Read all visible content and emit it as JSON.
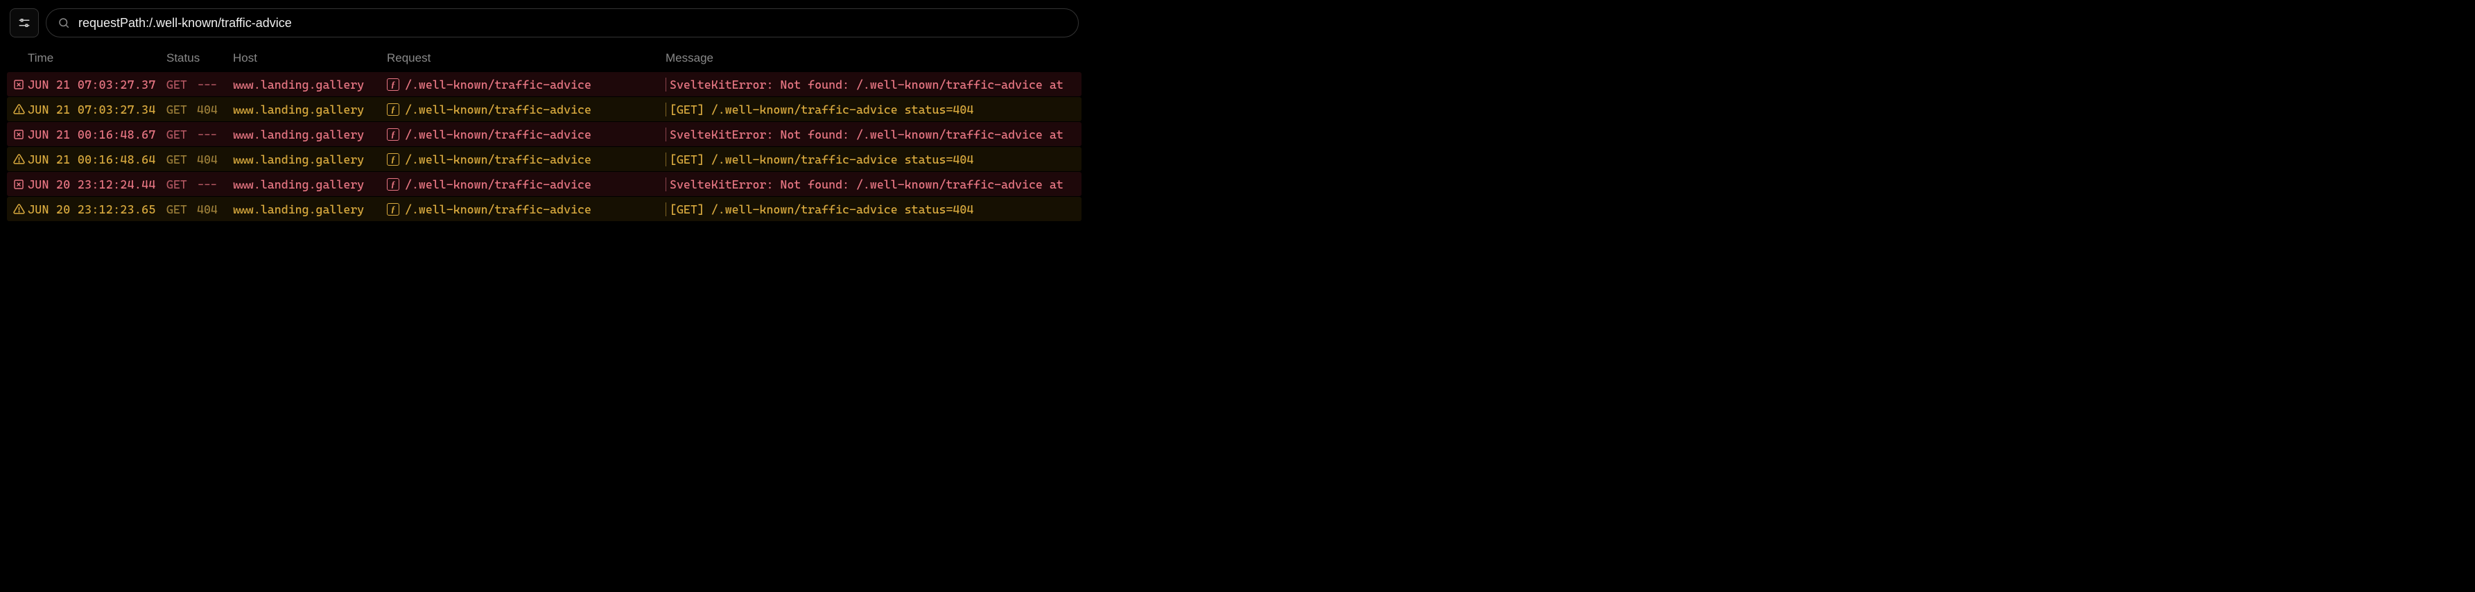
{
  "toolbar": {
    "search_value": "requestPath:/.well-known/traffic-advice"
  },
  "columns": {
    "time": "Time",
    "status": "Status",
    "host": "Host",
    "request": "Request",
    "message": "Message"
  },
  "logs": [
    {
      "level": "error",
      "time": "JUN 21 07:03:27.37",
      "method": "GET",
      "status": "---",
      "host": "www.landing.gallery",
      "request": "/.well-known/traffic-advice",
      "message": "SvelteKitError: Not found: /.well-known/traffic-advice at"
    },
    {
      "level": "warn",
      "time": "JUN 21 07:03:27.34",
      "method": "GET",
      "status": "404",
      "host": "www.landing.gallery",
      "request": "/.well-known/traffic-advice",
      "message": "[GET] /.well-known/traffic-advice status=404"
    },
    {
      "level": "error",
      "time": "JUN 21 00:16:48.67",
      "method": "GET",
      "status": "---",
      "host": "www.landing.gallery",
      "request": "/.well-known/traffic-advice",
      "message": "SvelteKitError: Not found: /.well-known/traffic-advice at"
    },
    {
      "level": "warn",
      "time": "JUN 21 00:16:48.64",
      "method": "GET",
      "status": "404",
      "host": "www.landing.gallery",
      "request": "/.well-known/traffic-advice",
      "message": "[GET] /.well-known/traffic-advice status=404"
    },
    {
      "level": "error",
      "time": "JUN 20 23:12:24.44",
      "method": "GET",
      "status": "---",
      "host": "www.landing.gallery",
      "request": "/.well-known/traffic-advice",
      "message": "SvelteKitError: Not found: /.well-known/traffic-advice at"
    },
    {
      "level": "warn",
      "time": "JUN 20 23:12:23.65",
      "method": "GET",
      "status": "404",
      "host": "www.landing.gallery",
      "request": "/.well-known/traffic-advice",
      "message": "[GET] /.well-known/traffic-advice status=404"
    }
  ],
  "fx_glyph": "ƒ"
}
